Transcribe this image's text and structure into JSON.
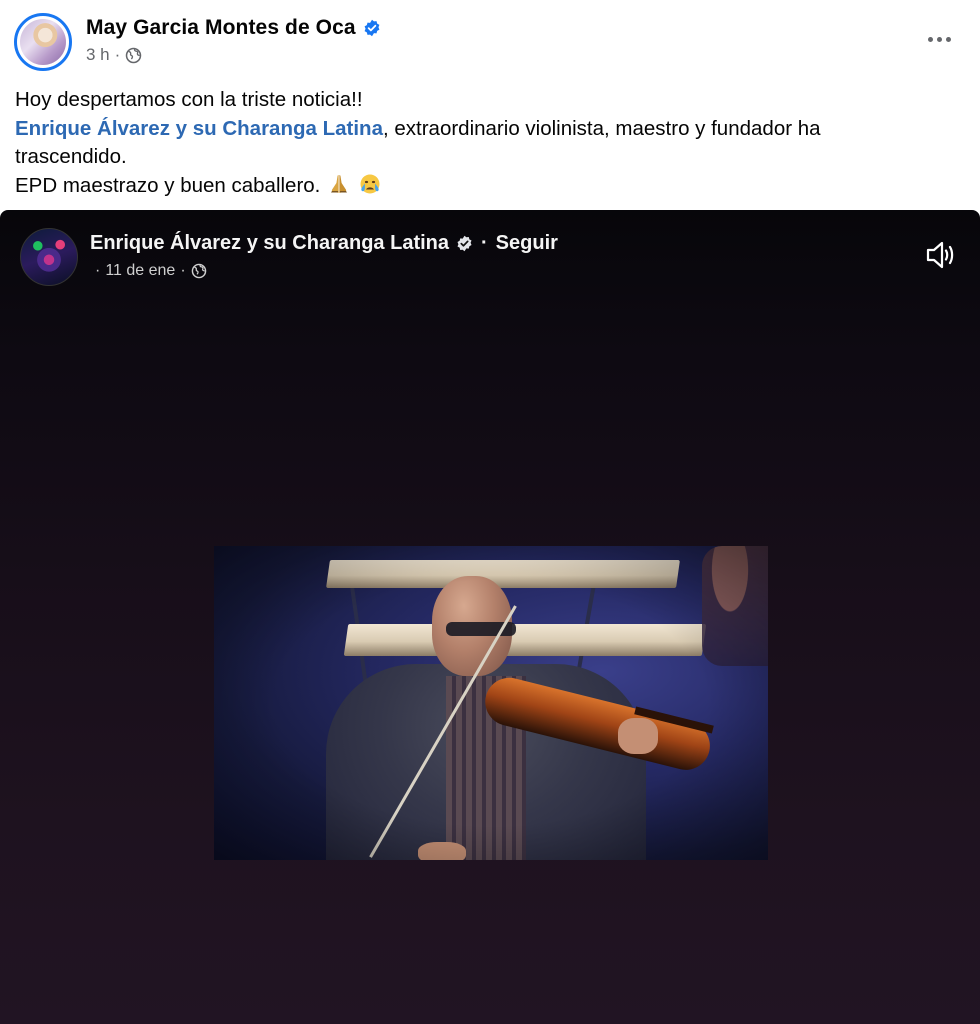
{
  "post": {
    "author": "May Garcia Montes de Oca",
    "time": "3 h",
    "caption": {
      "line1": "Hoy despertamos con la triste noticia!!",
      "mention": "Enrique Álvarez y su Charanga Latina",
      "line2_rest": ", extraordinario violinista, maestro y fundador ha",
      "line3": "trascendido.",
      "line4": "EPD maestrazo y buen  caballero.",
      "emojis": [
        "praying-hands",
        "crying-face"
      ]
    }
  },
  "shared": {
    "page_name": "Enrique Álvarez y su Charanga Latina",
    "follow_label": "Seguir",
    "date": "11 de ene"
  },
  "colors": {
    "verified_blue": "#1877f2",
    "mention_link": "#2d69b3",
    "meta_grey": "#65676b",
    "media_dark": "#1e121f"
  },
  "icons": {
    "header_more": "more-horizontal-icon",
    "privacy": "globe-icon",
    "sound": "speaker-on-icon",
    "verified": "verified-badge-icon"
  }
}
